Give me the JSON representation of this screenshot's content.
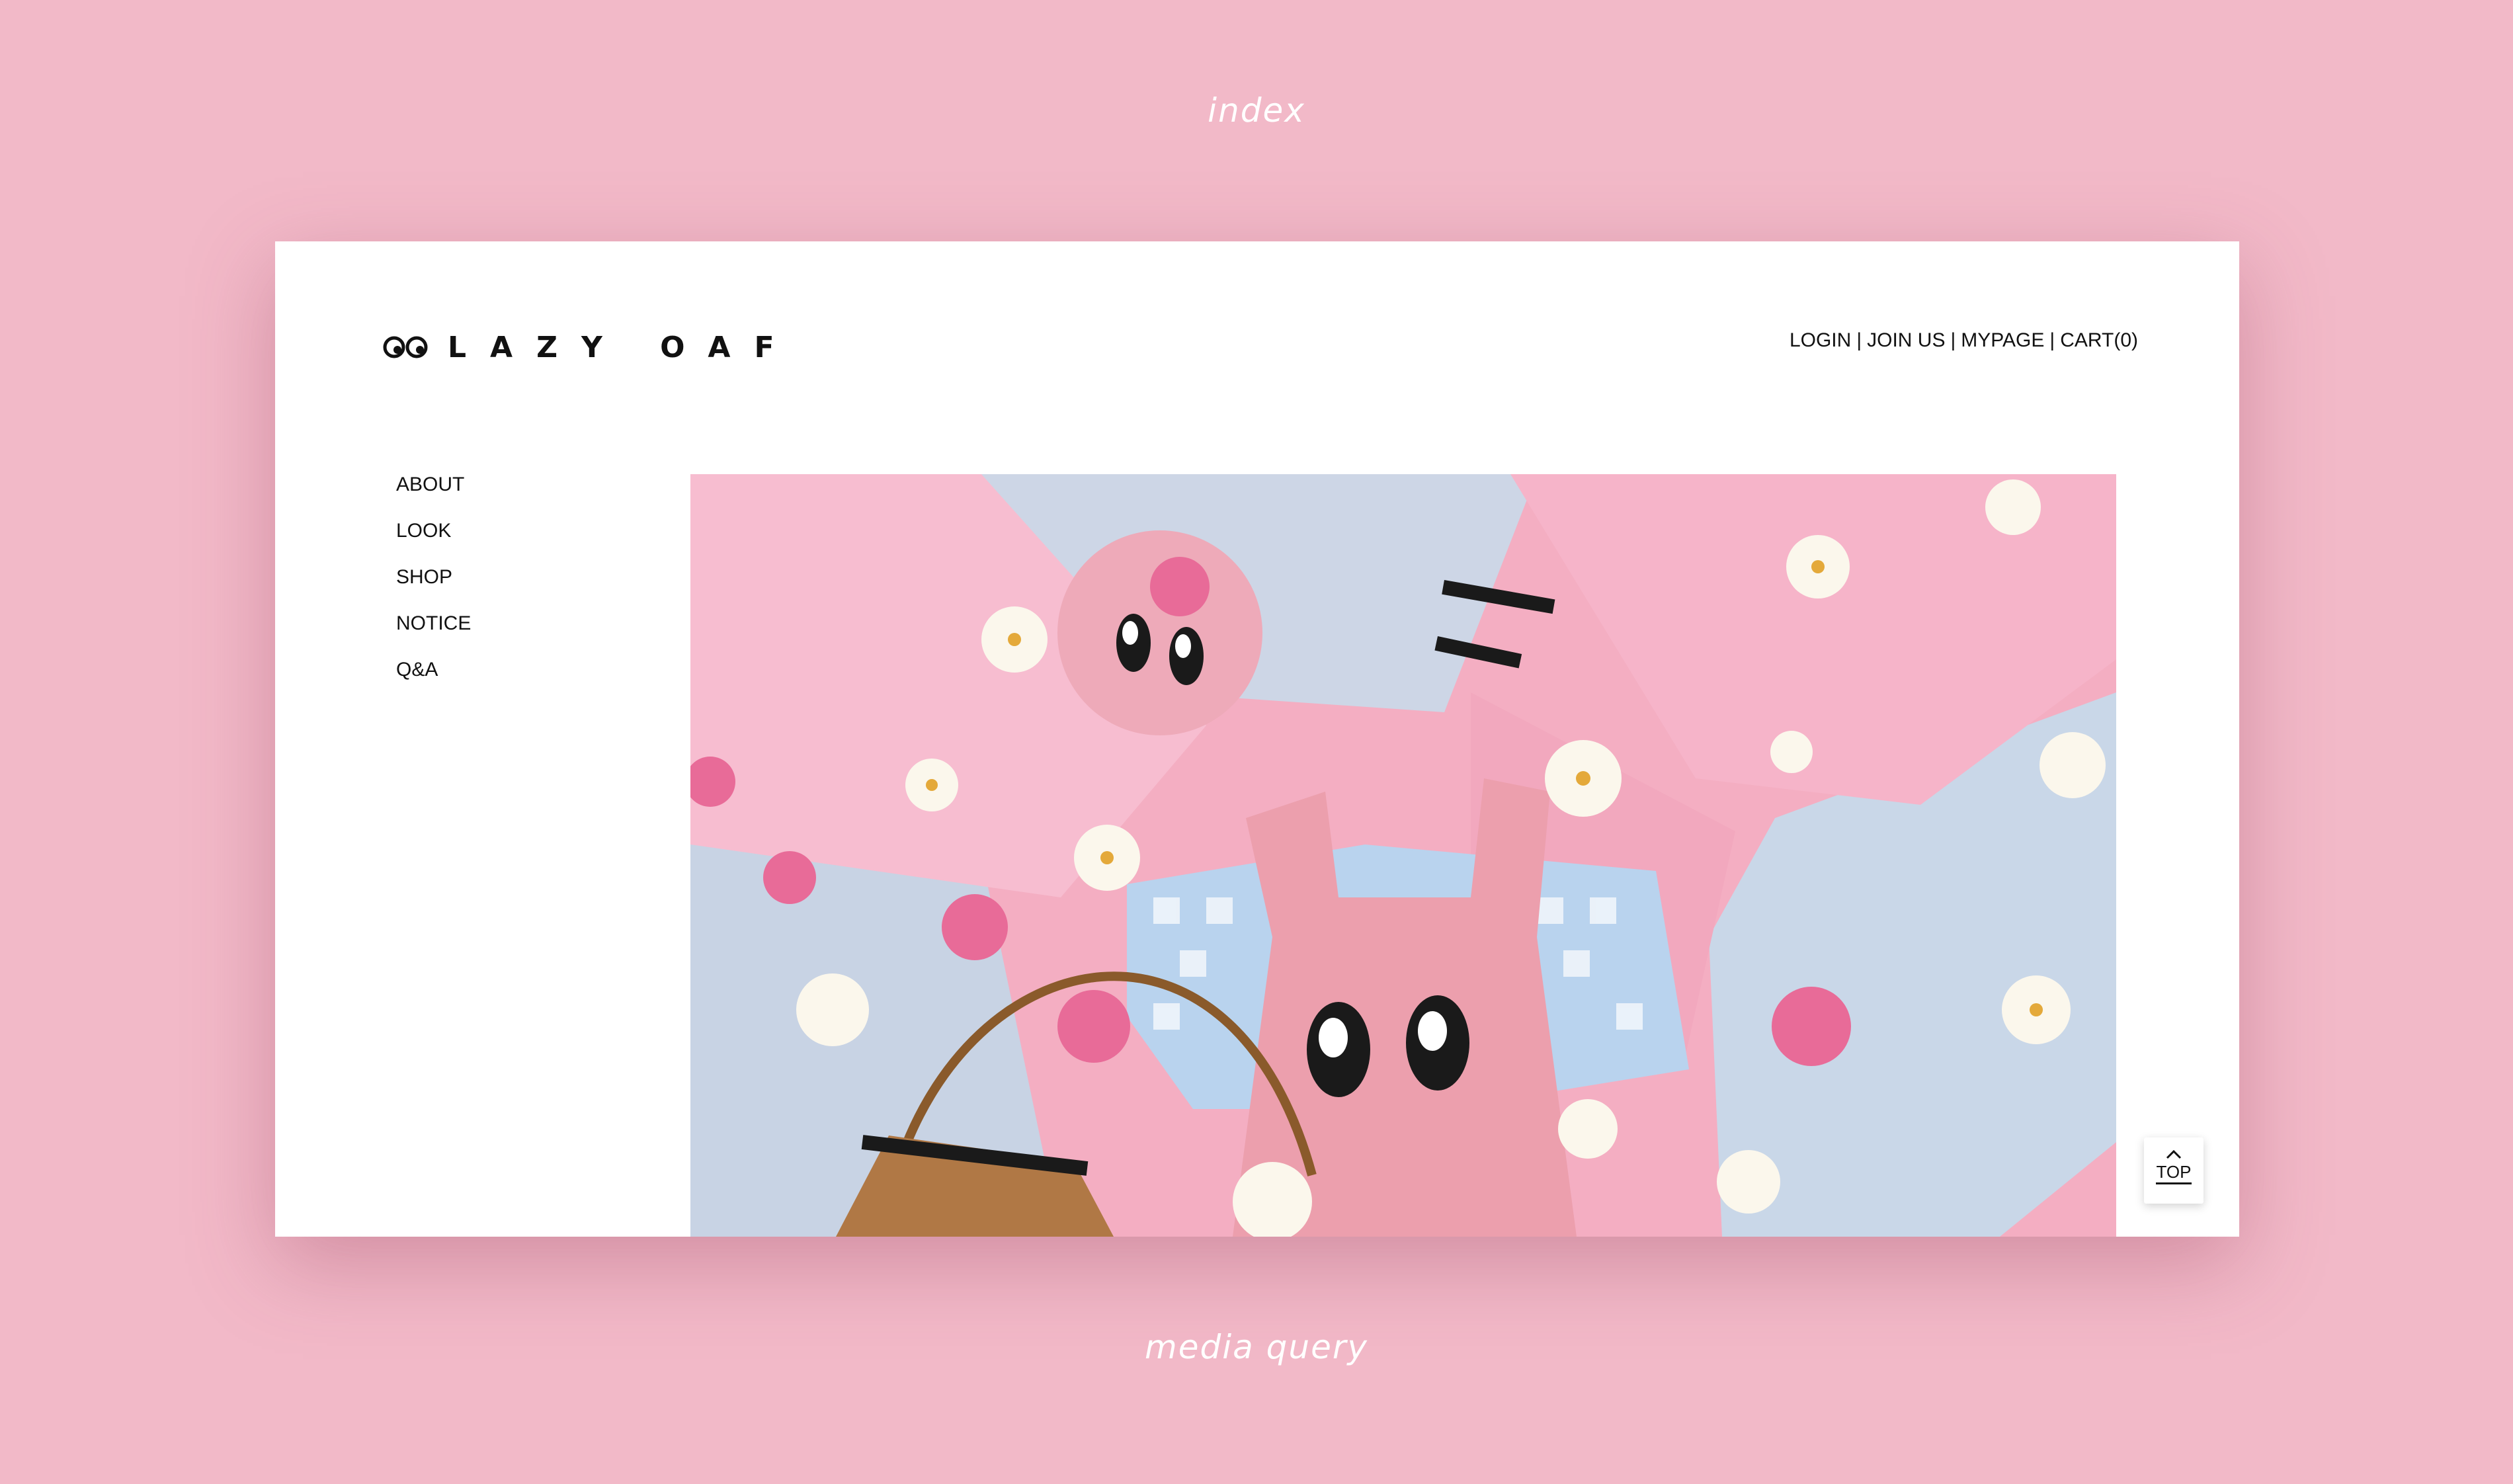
{
  "captions": {
    "top": "index",
    "bottom": "media query"
  },
  "brand": {
    "name": "LAZY OAF",
    "logo_icon": "eyes-logo-icon"
  },
  "top_nav": [
    {
      "label": "LOGIN"
    },
    {
      "label": "JOIN US"
    },
    {
      "label": "MYPAGE"
    },
    {
      "label": "CART(0)"
    }
  ],
  "side_nav": [
    {
      "label": "ABOUT"
    },
    {
      "label": "LOOK"
    },
    {
      "label": "SHOP"
    },
    {
      "label": "NOTICE"
    },
    {
      "label": "Q&A"
    }
  ],
  "top_button": {
    "label": "TOP",
    "icon": "chevron-up-icon"
  },
  "colors": {
    "background": "#f2b9c8",
    "window": "#ffffff",
    "text": "#111111",
    "hero_pink": "#f4aec2",
    "hero_blue": "#c9d7e8"
  }
}
